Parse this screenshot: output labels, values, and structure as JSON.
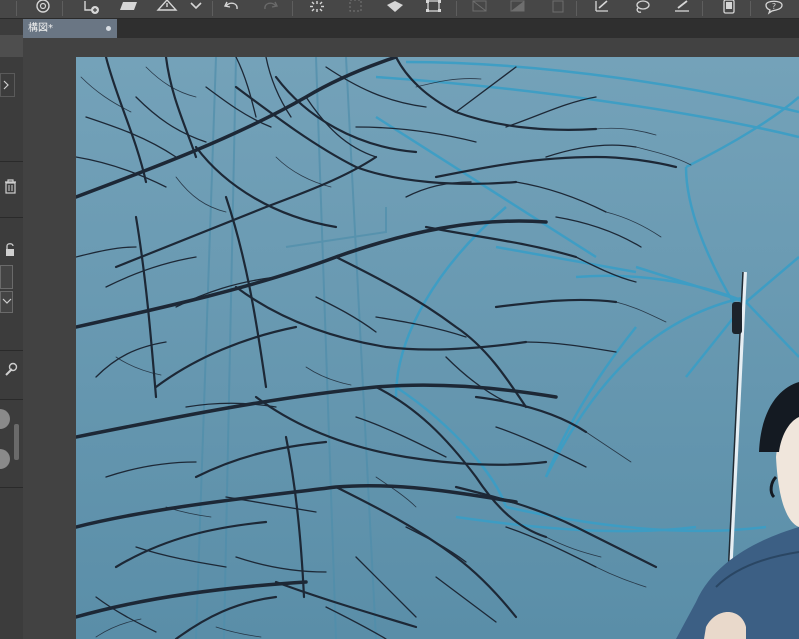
{
  "document": {
    "tab_title": "構図*"
  },
  "toolbar": {
    "icons": [
      "layer-stack-icon",
      "new-layer-icon",
      "folder-open-icon",
      "warning-icon",
      "chevron-down-icon",
      "undo-icon",
      "redo-icon",
      "loading-spinner-icon",
      "grid-select-icon",
      "fill-bucket-icon",
      "transform-icon",
      "clear-icon",
      "fill-icon",
      "ruler-icon",
      "pen-check-icon",
      "lasso-icon",
      "pen-line-icon",
      "device-icon",
      "help-icon"
    ]
  },
  "colors": {
    "sky_top": "#6f9fb7",
    "sky_bottom": "#5f92aa",
    "branch": "#1d2836",
    "umbrella_line": "#3a9ec6",
    "tab_active": "#6a7684"
  }
}
